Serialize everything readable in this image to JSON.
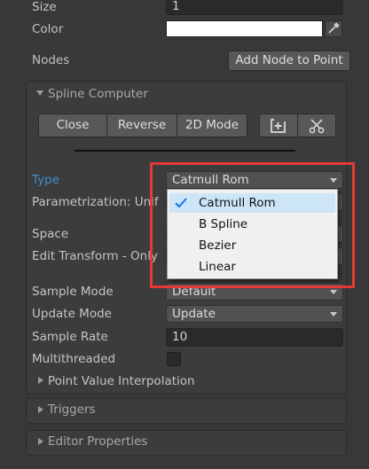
{
  "properties": {
    "size_label": "Size",
    "size_value": "1",
    "color_label": "Color",
    "nodes_label": "Nodes",
    "add_node_button": "Add Node to Point"
  },
  "spline_computer": {
    "title": "Spline Computer",
    "buttons": [
      "Close",
      "Reverse",
      "2D Mode"
    ],
    "type_label": "Type",
    "type_value": "Catmull Rom",
    "parametrization_label": "Parametrization: Unif",
    "space_label": "Space",
    "edit_transform_label": "Edit Transform - Only",
    "sample_mode_label": "Sample Mode",
    "sample_mode_value": "Default",
    "update_mode_label": "Update Mode",
    "update_mode_value": "Update",
    "sample_rate_label": "Sample Rate",
    "sample_rate_value": "10",
    "multithreaded_label": "Multithreaded",
    "point_value_interpolation": "Point Value Interpolation"
  },
  "type_dropdown_menu": {
    "options": [
      "Catmull Rom",
      "B Spline",
      "Bezier",
      "Linear"
    ],
    "selected": "Catmull Rom"
  },
  "sections": {
    "triggers": "Triggers",
    "editor_properties": "Editor Properties"
  },
  "colors": {
    "accent_label": "#3d8fd6",
    "highlight_box": "#e53935",
    "menu_bg": "#f0f0f0",
    "menu_check": "#1a73e8"
  }
}
